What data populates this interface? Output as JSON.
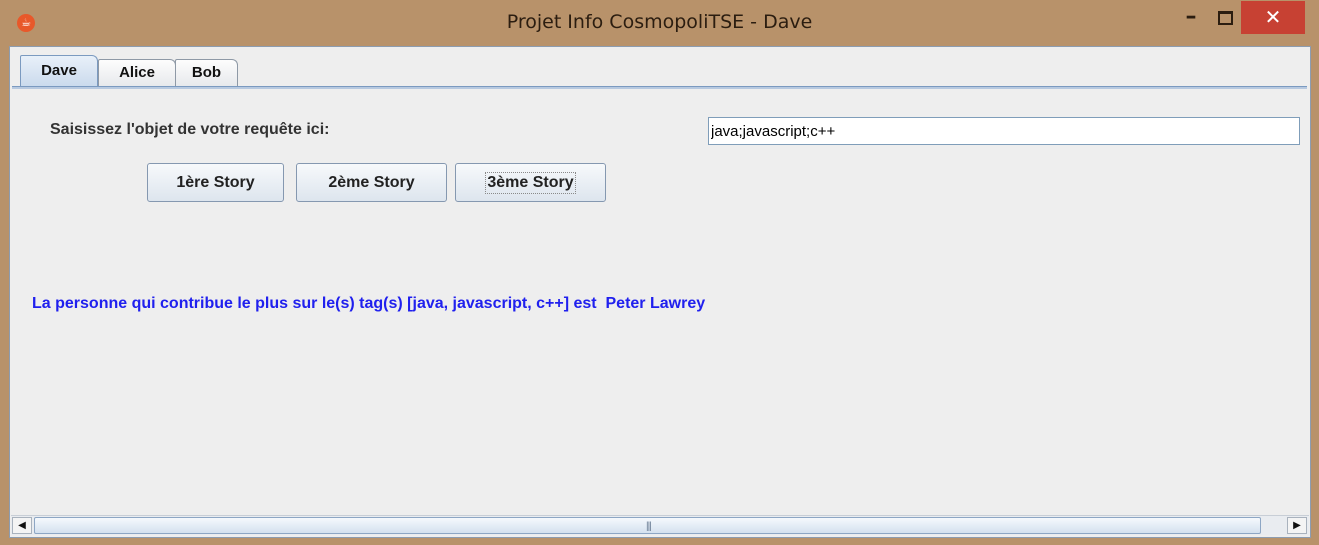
{
  "window": {
    "title": "Projet Info CosmopoliTSE - Dave",
    "icon": "java-coffee-icon",
    "minimize_glyph": "–",
    "close_glyph": "✕"
  },
  "tabs": [
    {
      "label": "Dave",
      "active": true
    },
    {
      "label": "Alice",
      "active": false
    },
    {
      "label": "Bob",
      "active": false
    }
  ],
  "form": {
    "prompt_label": "Saisissez l'objet de votre requête ici:",
    "query_value": "java;javascript;c++"
  },
  "buttons": {
    "story1": "1ère Story",
    "story2": "2ème Story",
    "story3": "3ème Story"
  },
  "result": {
    "text": "La personne qui contribue le plus sur le(s) tag(s) [java, javascript, c++] est  Peter Lawrey"
  },
  "scrollbar": {
    "left_arrow": "◀",
    "right_arrow": "▶",
    "grip": "|||"
  },
  "colors": {
    "window_frame": "#b8926a",
    "close_button": "#c74133",
    "result_text": "#2020ee",
    "panel_background": "#eeeeee"
  }
}
